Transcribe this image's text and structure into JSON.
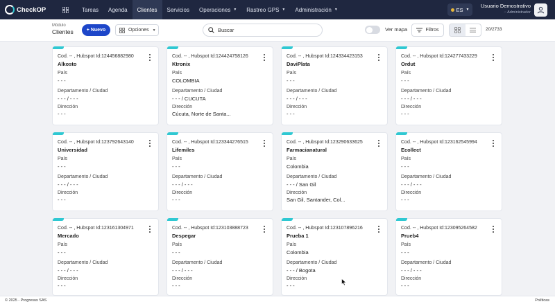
{
  "brand": {
    "name": "CheckOP"
  },
  "nav": {
    "items": [
      {
        "label": "Tareas",
        "dropdown": false
      },
      {
        "label": "Agenda",
        "dropdown": false
      },
      {
        "label": "Clientes",
        "dropdown": false,
        "active": true
      },
      {
        "label": "Servicios",
        "dropdown": false
      },
      {
        "label": "Operaciones",
        "dropdown": true
      },
      {
        "label": "Rastreo GPS",
        "dropdown": true
      },
      {
        "label": "Administración",
        "dropdown": true
      }
    ],
    "lang": "ES",
    "user_name": "Usuario Demostrativo",
    "user_role": "Administrador"
  },
  "toolbar": {
    "module_label": "Módulo",
    "module_title": "Clientes",
    "new_label": "+ Nuevo",
    "options_label": "Opciones",
    "search_placeholder": "Buscar",
    "map_label": "Ver mapa",
    "filters_label": "Filtros",
    "count": "20/2733"
  },
  "labels": {
    "country": "País",
    "dept_city": "Departamento / Ciudad",
    "address": "Dirección"
  },
  "cards": [
    {
      "head": "Cod. -- , Hubspot Id:124456882980",
      "name": "Alkosto",
      "country": "- - -",
      "dept_city": "- - - / - - -",
      "address": "- - -"
    },
    {
      "head": "Cod. -- , Hubspot Id:124424758126",
      "name": "Ktronix",
      "country": "COLOMBIA",
      "dept_city": "- - - / CUCUTA",
      "address": "Cúcuta, Norte de Santa..."
    },
    {
      "head": "Cod. -- , Hubspot Id:124334423153",
      "name": "DaviPlata",
      "country": "- - -",
      "dept_city": "- - - / - - -",
      "address": "- - -"
    },
    {
      "head": "Cod. -- , Hubspot Id:124277433229",
      "name": "Ordut",
      "country": "- - -",
      "dept_city": "- - - / - - -",
      "address": "- - -"
    },
    {
      "head": "Cod. -- , Hubspot Id:123792643140",
      "name": "Universidad",
      "country": "- - -",
      "dept_city": "- - - / - - -",
      "address": "- - -"
    },
    {
      "head": "Cod. -- , Hubspot Id:123344276515",
      "name": "Lifemiles",
      "country": "- - -",
      "dept_city": "- - - / - - -",
      "address": "- - -"
    },
    {
      "head": "Cod. -- , Hubspot Id:123290633625",
      "name": "Farmacianatural",
      "country": "Colombia",
      "dept_city": "- - - / San Gil",
      "address": "San Gil, Santander, Col..."
    },
    {
      "head": "Cod. -- , Hubspot Id:123162545994",
      "name": "Ecollect",
      "country": "- - -",
      "dept_city": "- - - / - - -",
      "address": "- - -"
    },
    {
      "head": "Cod. -- , Hubspot Id:123161304971",
      "name": "Mercado",
      "country": "- - -",
      "dept_city": "- - - / - - -",
      "address": "- - -"
    },
    {
      "head": "Cod. -- , Hubspot Id:123103888723",
      "name": "Despegar",
      "country": "- - -",
      "dept_city": "- - - / - - -",
      "address": "- - -"
    },
    {
      "head": "Cod. -- , Hubspot Id:123107896216",
      "name": "Prueba 1",
      "country": "Colombia",
      "dept_city": "- - - / Bogota",
      "address": "- - -"
    },
    {
      "head": "Cod. -- , Hubspot Id:123095264582",
      "name": "Prueb4",
      "country": "- - -",
      "dept_city": "- - - / - - -",
      "address": "- - -"
    }
  ],
  "footer": {
    "copyright": "© 2025 - Progresus SAS",
    "policies": "Políticas"
  },
  "colors": {
    "nav_bg": "#1f2740",
    "accent": "#1d46c9",
    "card_tab": "#2fc8d2"
  }
}
